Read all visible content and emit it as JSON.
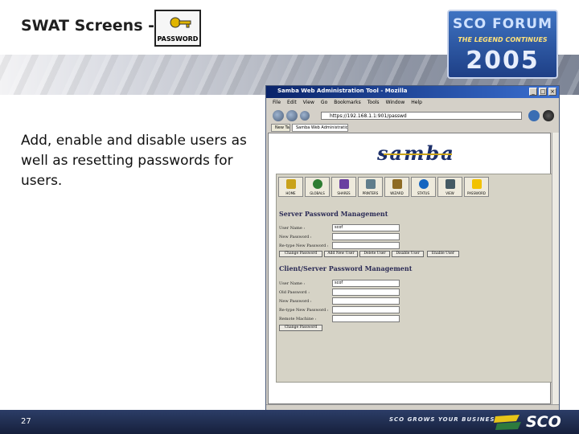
{
  "slide": {
    "title": "SWAT Screens -",
    "password_icon_label": "PASSWORD",
    "description": "Add, enable and disable users as well as resetting passwords for users.",
    "page_number": "27",
    "footer_tagline": "SCO GROWS YOUR BUSINESS",
    "footer_logo": "SCO"
  },
  "forum_logo": {
    "line1": "SCO FORUM",
    "line2": "THE LEGEND CONTINUES",
    "year": "2005"
  },
  "browser": {
    "window_title": "Samba Web Administration Tool - Mozilla",
    "menu": [
      "File",
      "Edit",
      "View",
      "Go",
      "Bookmarks",
      "Tools",
      "Window",
      "Help"
    ],
    "url": "https://192.168.1.1:901/passwd",
    "tabs": [
      "New Tab",
      "Samba Web Administration Tool"
    ]
  },
  "swat": {
    "logo": "samba",
    "nav": [
      "HOME",
      "GLOBALS",
      "SHARES",
      "PRINTERS",
      "WIZARD",
      "STATUS",
      "VIEW",
      "PASSWORD"
    ],
    "nav_colors": [
      "#c9a21a",
      "#2e7d32",
      "#6a3fa0",
      "#607d8b",
      "#8e6b23",
      "#1565c0",
      "#455a64",
      "#f2c200"
    ],
    "server_section": {
      "title": "Server Password Management",
      "fields": [
        {
          "label": "User Name :",
          "value": "scof"
        },
        {
          "label": "New Password :",
          "value": ""
        },
        {
          "label": "Re-type New Password :",
          "value": ""
        }
      ],
      "buttons": [
        "Change Password",
        "Add New User",
        "Delete User",
        "Disable User",
        "Enable User"
      ]
    },
    "client_section": {
      "title": "Client/Server Password Management",
      "fields": [
        {
          "label": "User Name :",
          "value": "scof"
        },
        {
          "label": "Old Password :",
          "value": ""
        },
        {
          "label": "New Password :",
          "value": ""
        },
        {
          "label": "Re-type New Password :",
          "value": ""
        },
        {
          "label": "Remote Machine :",
          "value": ""
        }
      ],
      "button": "Change Password"
    }
  }
}
